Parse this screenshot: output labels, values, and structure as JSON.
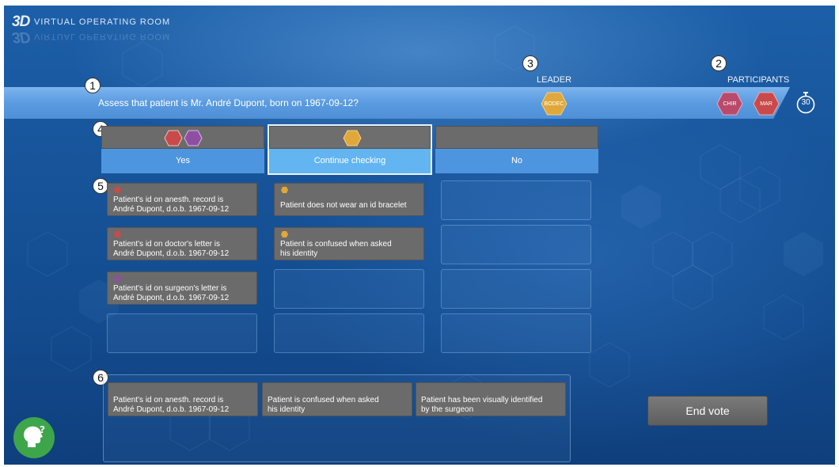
{
  "app": {
    "logo_mark": "3D",
    "logo_text": "VIRTUAL OPERATING ROOM"
  },
  "callouts": [
    "1",
    "2",
    "3",
    "4",
    "5",
    "6"
  ],
  "header": {
    "leader_label": "LEADER",
    "participants_label": "PARTICIPANTS",
    "question": "Assess that patient is Mr. André Dupont, born on 1967-09-12?",
    "leader": {
      "name": "BODEC",
      "color": "#e0a83a"
    },
    "participants": [
      {
        "name": "CHIR",
        "color": "#b94a6c"
      },
      {
        "name": "MAR",
        "color": "#c94a4a"
      }
    ],
    "timer": "30"
  },
  "columns": [
    {
      "label": "Yes",
      "selected": false,
      "voters": [
        {
          "color": "#c94a4a"
        },
        {
          "color": "#8e4fa3"
        }
      ]
    },
    {
      "label": "Continue checking",
      "selected": true,
      "voters": [
        {
          "color": "#e0a83a"
        }
      ]
    },
    {
      "label": "No",
      "selected": false,
      "voters": []
    }
  ],
  "cards": {
    "yes": [
      {
        "color": "#c94a4a",
        "line1": "Patient's id on anesth. record is",
        "line2": "André Dupont, d.o.b. 1967-09-12"
      },
      {
        "color": "#c94a4a",
        "line1": "Patient's id on doctor's letter is",
        "line2": "André Dupont, d.o.b. 1967-09-12"
      },
      {
        "color": "#8e4fa3",
        "line1": "Patient's id on surgeon's letter is",
        "line2": "André Dupont, d.o.b. 1967-09-12"
      }
    ],
    "continue": [
      {
        "color": "#e0a83a",
        "line1": "Patient does not wear an id bracelet"
      },
      {
        "color": "#e0a83a",
        "line1": "Patient is confused when asked",
        "line2": "his identity"
      }
    ]
  },
  "bottom": [
    {
      "line1": "Patient's id on anesth. record is",
      "line2": "André Dupont, d.o.b. 1967-09-12"
    },
    {
      "line1": "Patient is confused when asked",
      "line2": "his identity"
    },
    {
      "line1": "Patient has been visually identified",
      "line2": "by the surgeon"
    }
  ],
  "end_vote_label": "End vote",
  "help": {
    "color": "#3ea64a",
    "icon": "help-head-icon"
  }
}
